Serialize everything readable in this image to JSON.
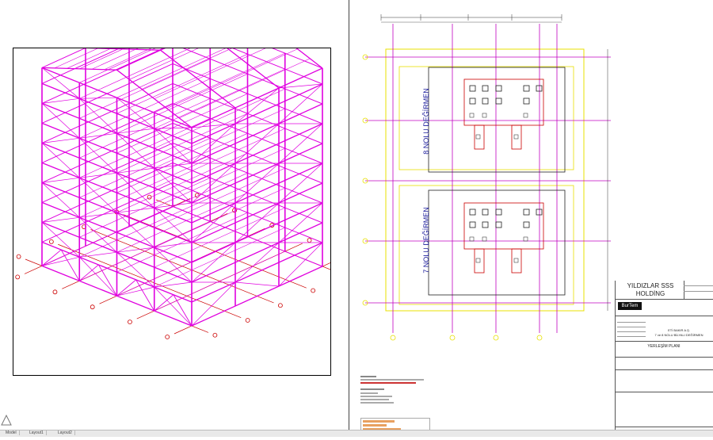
{
  "drawing": {
    "mill_8_label": "8 NOLU DEĞİRMEN",
    "mill_7_label": "7 NOLU DEĞİRMEN"
  },
  "title_block": {
    "client_line1": "YILDIZLAR SSS",
    "client_line2": "HOLDİNG",
    "company_logo_text": "BurTem",
    "sheet_title": "YERLEŞİM PLANI",
    "project_line1": "ETİ BAKIR A.Ş.",
    "project_line2": "7 ve 8 NOLU BİLYALI DEĞİRMEN"
  },
  "colors": {
    "structure": "#e000e0",
    "grid_yellow": "#e8e000",
    "grid_magenta": "#c000c0",
    "foundation_red": "#cc0000",
    "text_blue": "#1a1a9a"
  },
  "status_tabs": [
    "Model",
    "Layout1",
    "Layout2"
  ]
}
